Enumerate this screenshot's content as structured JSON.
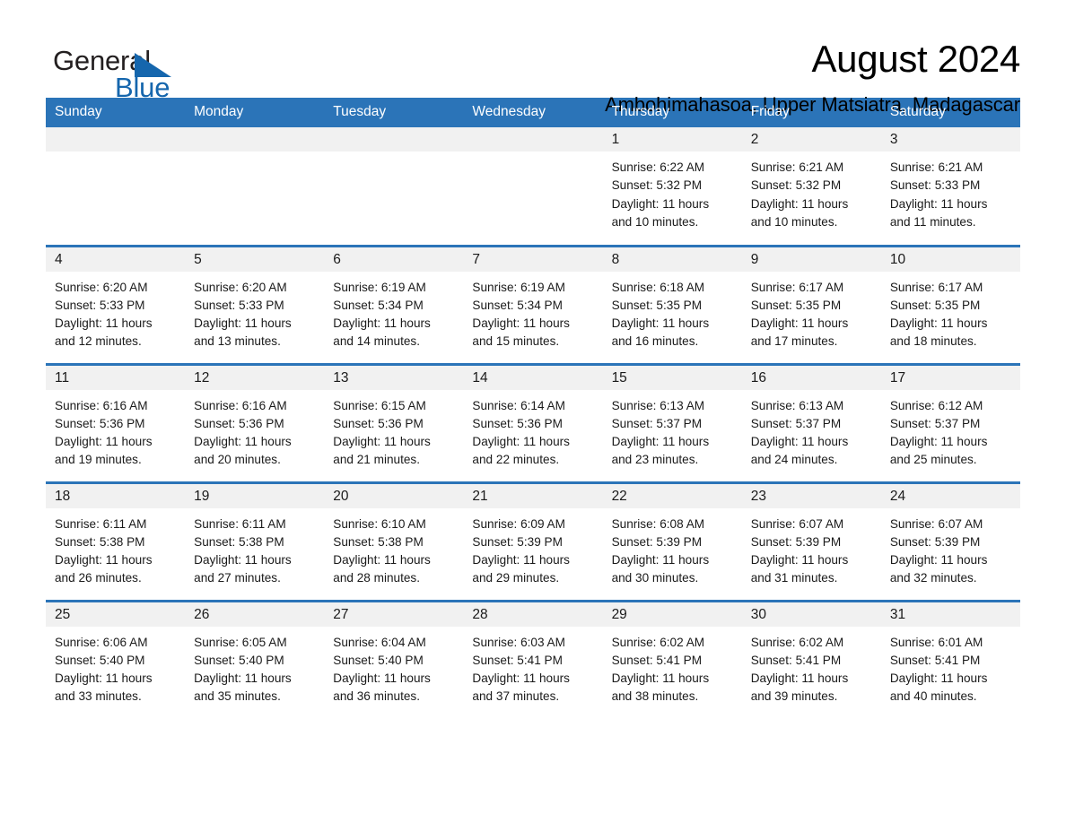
{
  "brand": {
    "name_part1": "General",
    "name_part2": "Blue",
    "triangle_color": "#1566ad",
    "text_color": "#231f20"
  },
  "header": {
    "title": "August 2024",
    "subtitle": "Ambohimahasoa, Upper Matsiatra, Madagascar"
  },
  "theme": {
    "header_blue": "#2b74b8",
    "daynum_band": "#f1f1f1",
    "page_background": "#ffffff",
    "text": "#1a1a1a"
  },
  "calendar": {
    "weekday_headers": [
      "Sunday",
      "Monday",
      "Tuesday",
      "Wednesday",
      "Thursday",
      "Friday",
      "Saturday"
    ],
    "labels": {
      "sunrise_prefix": "Sunrise:",
      "sunset_prefix": "Sunset:",
      "daylight_prefix": "Daylight:"
    },
    "weeks": [
      [
        {
          "day": "",
          "empty": true
        },
        {
          "day": "",
          "empty": true
        },
        {
          "day": "",
          "empty": true
        },
        {
          "day": "",
          "empty": true
        },
        {
          "day": "1",
          "sunrise": "Sunrise: 6:22 AM",
          "sunset": "Sunset: 5:32 PM",
          "daylight_line1": "Daylight: 11 hours",
          "daylight_line2": "and 10 minutes."
        },
        {
          "day": "2",
          "sunrise": "Sunrise: 6:21 AM",
          "sunset": "Sunset: 5:32 PM",
          "daylight_line1": "Daylight: 11 hours",
          "daylight_line2": "and 10 minutes."
        },
        {
          "day": "3",
          "sunrise": "Sunrise: 6:21 AM",
          "sunset": "Sunset: 5:33 PM",
          "daylight_line1": "Daylight: 11 hours",
          "daylight_line2": "and 11 minutes."
        }
      ],
      [
        {
          "day": "4",
          "sunrise": "Sunrise: 6:20 AM",
          "sunset": "Sunset: 5:33 PM",
          "daylight_line1": "Daylight: 11 hours",
          "daylight_line2": "and 12 minutes."
        },
        {
          "day": "5",
          "sunrise": "Sunrise: 6:20 AM",
          "sunset": "Sunset: 5:33 PM",
          "daylight_line1": "Daylight: 11 hours",
          "daylight_line2": "and 13 minutes."
        },
        {
          "day": "6",
          "sunrise": "Sunrise: 6:19 AM",
          "sunset": "Sunset: 5:34 PM",
          "daylight_line1": "Daylight: 11 hours",
          "daylight_line2": "and 14 minutes."
        },
        {
          "day": "7",
          "sunrise": "Sunrise: 6:19 AM",
          "sunset": "Sunset: 5:34 PM",
          "daylight_line1": "Daylight: 11 hours",
          "daylight_line2": "and 15 minutes."
        },
        {
          "day": "8",
          "sunrise": "Sunrise: 6:18 AM",
          "sunset": "Sunset: 5:35 PM",
          "daylight_line1": "Daylight: 11 hours",
          "daylight_line2": "and 16 minutes."
        },
        {
          "day": "9",
          "sunrise": "Sunrise: 6:17 AM",
          "sunset": "Sunset: 5:35 PM",
          "daylight_line1": "Daylight: 11 hours",
          "daylight_line2": "and 17 minutes."
        },
        {
          "day": "10",
          "sunrise": "Sunrise: 6:17 AM",
          "sunset": "Sunset: 5:35 PM",
          "daylight_line1": "Daylight: 11 hours",
          "daylight_line2": "and 18 minutes."
        }
      ],
      [
        {
          "day": "11",
          "sunrise": "Sunrise: 6:16 AM",
          "sunset": "Sunset: 5:36 PM",
          "daylight_line1": "Daylight: 11 hours",
          "daylight_line2": "and 19 minutes."
        },
        {
          "day": "12",
          "sunrise": "Sunrise: 6:16 AM",
          "sunset": "Sunset: 5:36 PM",
          "daylight_line1": "Daylight: 11 hours",
          "daylight_line2": "and 20 minutes."
        },
        {
          "day": "13",
          "sunrise": "Sunrise: 6:15 AM",
          "sunset": "Sunset: 5:36 PM",
          "daylight_line1": "Daylight: 11 hours",
          "daylight_line2": "and 21 minutes."
        },
        {
          "day": "14",
          "sunrise": "Sunrise: 6:14 AM",
          "sunset": "Sunset: 5:36 PM",
          "daylight_line1": "Daylight: 11 hours",
          "daylight_line2": "and 22 minutes."
        },
        {
          "day": "15",
          "sunrise": "Sunrise: 6:13 AM",
          "sunset": "Sunset: 5:37 PM",
          "daylight_line1": "Daylight: 11 hours",
          "daylight_line2": "and 23 minutes."
        },
        {
          "day": "16",
          "sunrise": "Sunrise: 6:13 AM",
          "sunset": "Sunset: 5:37 PM",
          "daylight_line1": "Daylight: 11 hours",
          "daylight_line2": "and 24 minutes."
        },
        {
          "day": "17",
          "sunrise": "Sunrise: 6:12 AM",
          "sunset": "Sunset: 5:37 PM",
          "daylight_line1": "Daylight: 11 hours",
          "daylight_line2": "and 25 minutes."
        }
      ],
      [
        {
          "day": "18",
          "sunrise": "Sunrise: 6:11 AM",
          "sunset": "Sunset: 5:38 PM",
          "daylight_line1": "Daylight: 11 hours",
          "daylight_line2": "and 26 minutes."
        },
        {
          "day": "19",
          "sunrise": "Sunrise: 6:11 AM",
          "sunset": "Sunset: 5:38 PM",
          "daylight_line1": "Daylight: 11 hours",
          "daylight_line2": "and 27 minutes."
        },
        {
          "day": "20",
          "sunrise": "Sunrise: 6:10 AM",
          "sunset": "Sunset: 5:38 PM",
          "daylight_line1": "Daylight: 11 hours",
          "daylight_line2": "and 28 minutes."
        },
        {
          "day": "21",
          "sunrise": "Sunrise: 6:09 AM",
          "sunset": "Sunset: 5:39 PM",
          "daylight_line1": "Daylight: 11 hours",
          "daylight_line2": "and 29 minutes."
        },
        {
          "day": "22",
          "sunrise": "Sunrise: 6:08 AM",
          "sunset": "Sunset: 5:39 PM",
          "daylight_line1": "Daylight: 11 hours",
          "daylight_line2": "and 30 minutes."
        },
        {
          "day": "23",
          "sunrise": "Sunrise: 6:07 AM",
          "sunset": "Sunset: 5:39 PM",
          "daylight_line1": "Daylight: 11 hours",
          "daylight_line2": "and 31 minutes."
        },
        {
          "day": "24",
          "sunrise": "Sunrise: 6:07 AM",
          "sunset": "Sunset: 5:39 PM",
          "daylight_line1": "Daylight: 11 hours",
          "daylight_line2": "and 32 minutes."
        }
      ],
      [
        {
          "day": "25",
          "sunrise": "Sunrise: 6:06 AM",
          "sunset": "Sunset: 5:40 PM",
          "daylight_line1": "Daylight: 11 hours",
          "daylight_line2": "and 33 minutes."
        },
        {
          "day": "26",
          "sunrise": "Sunrise: 6:05 AM",
          "sunset": "Sunset: 5:40 PM",
          "daylight_line1": "Daylight: 11 hours",
          "daylight_line2": "and 35 minutes."
        },
        {
          "day": "27",
          "sunrise": "Sunrise: 6:04 AM",
          "sunset": "Sunset: 5:40 PM",
          "daylight_line1": "Daylight: 11 hours",
          "daylight_line2": "and 36 minutes."
        },
        {
          "day": "28",
          "sunrise": "Sunrise: 6:03 AM",
          "sunset": "Sunset: 5:41 PM",
          "daylight_line1": "Daylight: 11 hours",
          "daylight_line2": "and 37 minutes."
        },
        {
          "day": "29",
          "sunrise": "Sunrise: 6:02 AM",
          "sunset": "Sunset: 5:41 PM",
          "daylight_line1": "Daylight: 11 hours",
          "daylight_line2": "and 38 minutes."
        },
        {
          "day": "30",
          "sunrise": "Sunrise: 6:02 AM",
          "sunset": "Sunset: 5:41 PM",
          "daylight_line1": "Daylight: 11 hours",
          "daylight_line2": "and 39 minutes."
        },
        {
          "day": "31",
          "sunrise": "Sunrise: 6:01 AM",
          "sunset": "Sunset: 5:41 PM",
          "daylight_line1": "Daylight: 11 hours",
          "daylight_line2": "and 40 minutes."
        }
      ]
    ]
  }
}
